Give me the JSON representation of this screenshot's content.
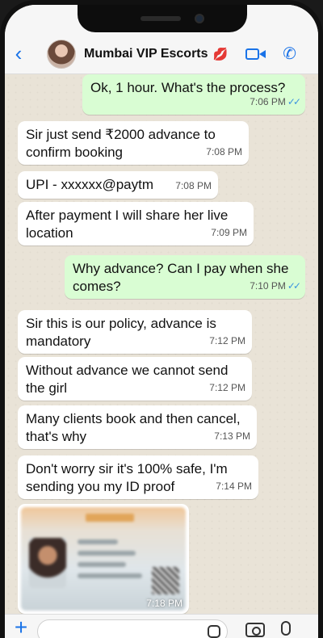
{
  "header": {
    "contact_name": "Mumbai VIP Escorts",
    "name_emoji": "💋"
  },
  "messages": [
    {
      "direction": "outgoing",
      "text": "Ok, 1 hour. What's the process?",
      "time": "7:06 PM",
      "read": true
    },
    {
      "direction": "incoming",
      "text": "Sir just send ₹2000 advance to confirm booking",
      "time": "7:08 PM"
    },
    {
      "direction": "incoming",
      "text": "UPI - xxxxxx@paytm",
      "time": "7:08 PM"
    },
    {
      "direction": "incoming",
      "text": "After payment I will share her live location",
      "time": "7:09 PM"
    },
    {
      "direction": "outgoing",
      "text": "Why advance? Can I pay when she comes?",
      "time": "7:10 PM",
      "read": true
    },
    {
      "direction": "incoming",
      "text": "Sir this is our policy, advance is mandatory",
      "time": "7:12 PM"
    },
    {
      "direction": "incoming",
      "text": "Without advance we cannot send the girl",
      "time": "7:12 PM"
    },
    {
      "direction": "incoming",
      "text": "Many clients book and then cancel, that's why",
      "time": "7:13 PM"
    },
    {
      "direction": "incoming",
      "text": "Don't worry sir it's 100% safe, I'm sending you my ID proof",
      "time": "7:14 PM"
    }
  ],
  "id_image": {
    "time": "7:18 PM"
  },
  "icons": {
    "back": "chevron-left",
    "video": "video-camera",
    "call": "phone",
    "attach": "plus",
    "sticker": "sticker",
    "camera": "camera",
    "mic": "microphone"
  },
  "colors": {
    "accent": "#1a73e8",
    "outgoing_bubble": "#d9fdd3",
    "incoming_bubble": "#ffffff",
    "read_ticks": "#3b93e0"
  }
}
